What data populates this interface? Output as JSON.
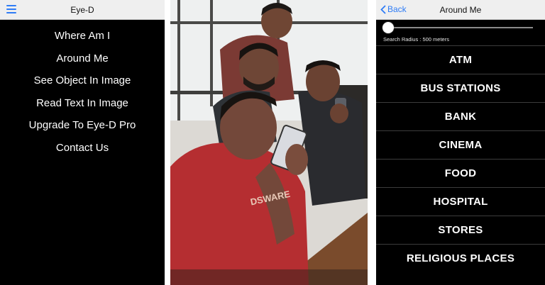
{
  "left_screen": {
    "title": "Eye-D",
    "menu": [
      {
        "label": "Where Am I"
      },
      {
        "label": "Around Me"
      },
      {
        "label": "See Object In Image"
      },
      {
        "label": "Read Text In Image"
      },
      {
        "label": "Upgrade To Eye-D Pro"
      },
      {
        "label": "Contact Us"
      }
    ]
  },
  "photo": {
    "shirt_text": "DSWARE"
  },
  "right_screen": {
    "back_label": "Back",
    "title": "Around Me",
    "search_radius_label": "Search Radius : 500 meters",
    "search_radius_slider_fraction": 0,
    "categories": [
      {
        "label": "ATM"
      },
      {
        "label": "BUS STATIONS"
      },
      {
        "label": "BANK"
      },
      {
        "label": "CINEMA"
      },
      {
        "label": "FOOD"
      },
      {
        "label": "HOSPITAL"
      },
      {
        "label": "STORES"
      },
      {
        "label": "RELIGIOUS PLACES"
      }
    ]
  },
  "colors": {
    "ios_blue": "#2f7cf6",
    "nav_bar": "#efefef",
    "screen_bg": "#000000"
  }
}
